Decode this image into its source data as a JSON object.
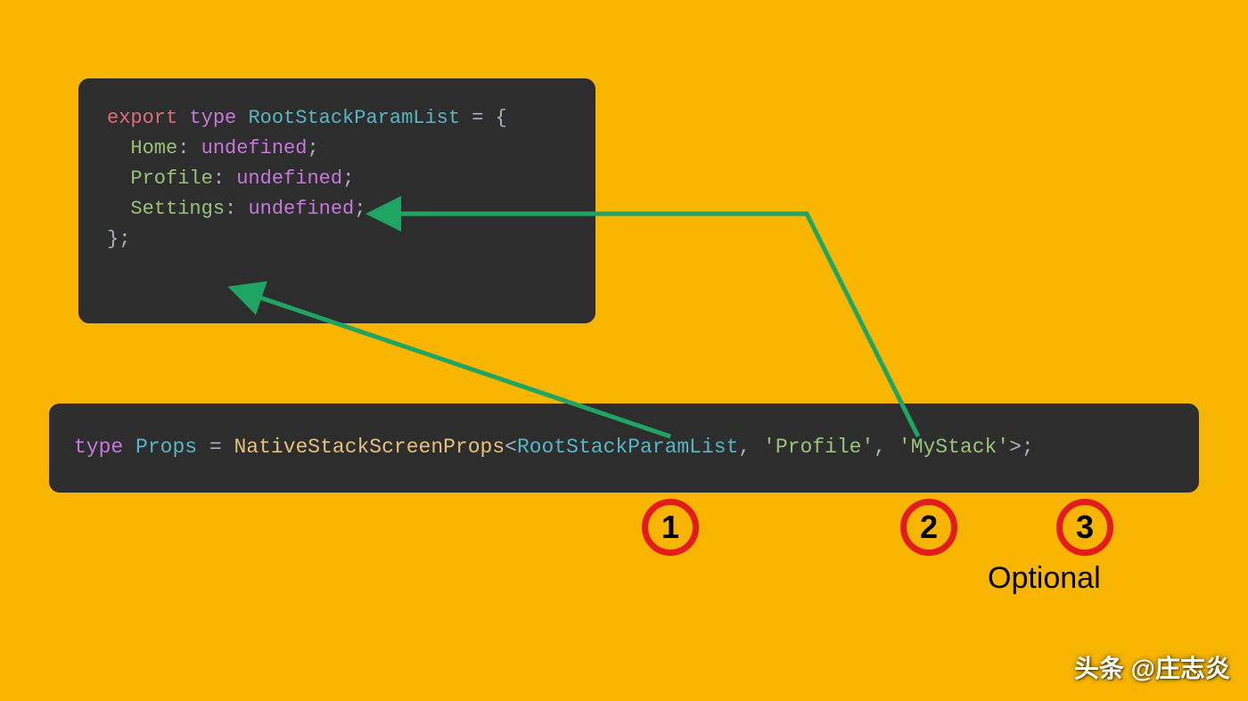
{
  "code_block_1": {
    "tokens": {
      "export": "export",
      "type_kw": "type",
      "type_name": "RootStackParamList",
      "eq_open": "= {",
      "field_home": "Home",
      "field_profile": "Profile",
      "field_settings": "Settings",
      "colon": ":",
      "undefined": "undefined",
      "semi": ";",
      "close": "};"
    }
  },
  "code_block_2": {
    "tokens": {
      "type_kw": "type",
      "props": "Props",
      "eq": "=",
      "generic": "NativeStackScreenProps",
      "lt": "<",
      "param_list": "RootStackParamList",
      "comma": ",",
      "str_profile": "'Profile'",
      "str_mystack": "'MyStack'",
      "gt_semi": ">;"
    }
  },
  "badges": {
    "b1": "1",
    "b2": "2",
    "b3": "3"
  },
  "optional_label": "Optional",
  "watermark": "头条 @庄志炎",
  "arrow_color": "#1FA463"
}
